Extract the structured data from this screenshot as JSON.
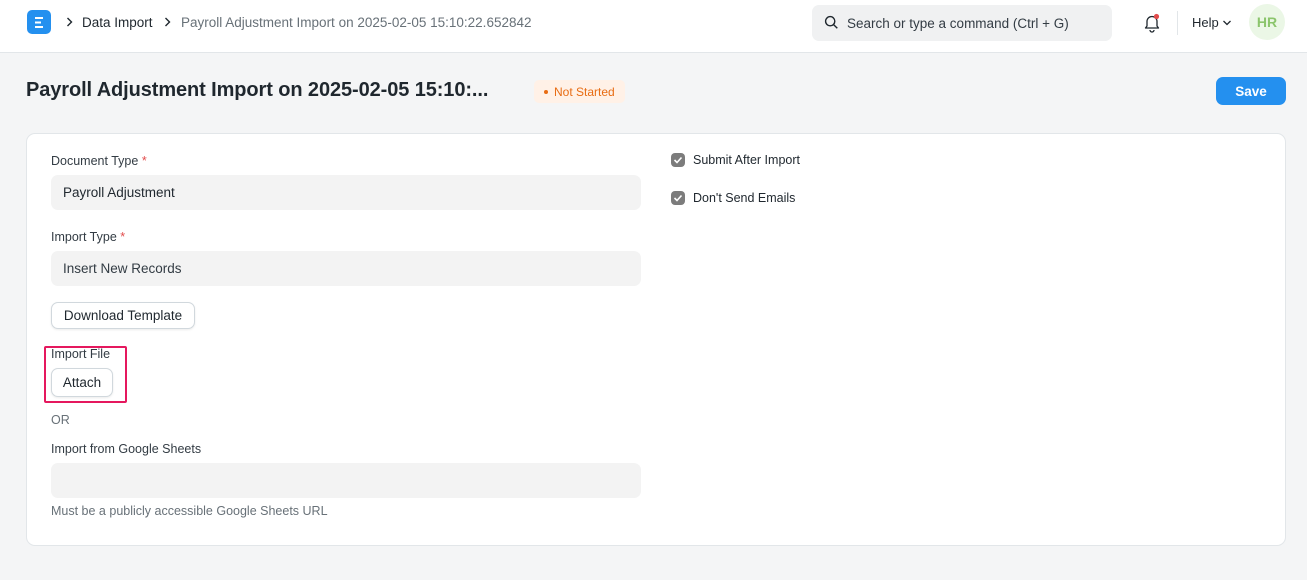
{
  "navbar": {
    "logo_letter": "E",
    "breadcrumbs": [
      "Data Import",
      "Payroll Adjustment Import on 2025-02-05 15:10:22.652842"
    ],
    "search_placeholder": "Search or type a command (Ctrl + G)",
    "help_label": "Help",
    "avatar_initials": "HR"
  },
  "page": {
    "title": "Payroll Adjustment Import on 2025-02-05 15:10:...",
    "status": "Not Started",
    "save_label": "Save"
  },
  "form": {
    "document_type": {
      "label": "Document Type",
      "required_mark": "*",
      "value": "Payroll Adjustment"
    },
    "import_type": {
      "label": "Import Type",
      "required_mark": "*",
      "value": "Insert New Records"
    },
    "download_template_label": "Download Template",
    "import_file": {
      "label": "Import File",
      "attach_label": "Attach"
    },
    "or_text": "OR",
    "google_sheets": {
      "label": "Import from Google Sheets",
      "value": "",
      "help": "Must be a publicly accessible Google Sheets URL"
    },
    "submit_after_import": {
      "label": "Submit After Import",
      "checked": true
    },
    "dont_send_emails": {
      "label": "Don't Send Emails",
      "checked": true
    }
  },
  "colors": {
    "primary": "#2490ef",
    "status_orange": "#e86c13",
    "highlight": "#e5185e"
  },
  "icons": [
    "app-logo-icon",
    "chevron-right-icon",
    "search-icon",
    "bell-icon",
    "chevron-down-icon",
    "check-icon"
  ]
}
